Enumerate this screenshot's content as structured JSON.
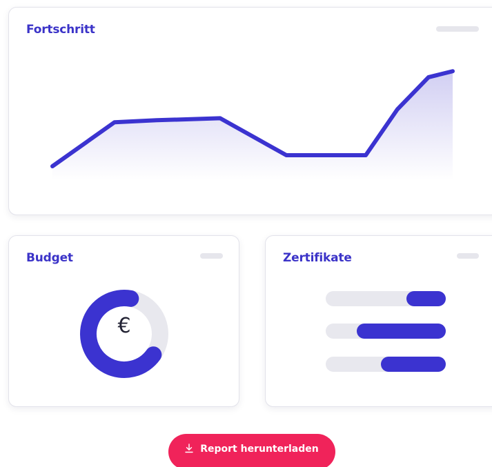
{
  "progress_card": {
    "title": "Fortschritt",
    "line_color": "#3b33d0",
    "fill_color": "#c9c6f0",
    "series": [
      0.0,
      0.44,
      0.46,
      0.48,
      0.11,
      0.11,
      0.57,
      0.89,
      0.95
    ]
  },
  "budget_card": {
    "title": "Budget",
    "icon": "euro-icon",
    "symbol": "€",
    "spent_fraction": 0.68,
    "ring_color": "#3b33d0",
    "track_color": "#e8e8ee"
  },
  "certificates_card": {
    "title": "Zertifikate",
    "bars": [
      {
        "start": 0.67,
        "end": 1.0
      },
      {
        "start": 0.26,
        "end": 1.0
      },
      {
        "start": 0.46,
        "end": 1.0
      }
    ]
  },
  "download_button": {
    "label": "Report herunterladen",
    "icon": "download-icon",
    "color": "#f0235a"
  }
}
